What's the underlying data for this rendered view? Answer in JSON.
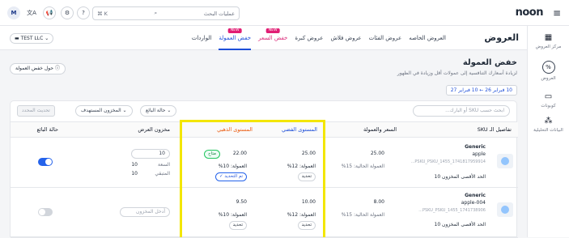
{
  "header": {
    "logo": "noon",
    "search_placeholder": "عمليات البحث",
    "search_shortcut": "K ⌘",
    "avatar_initial": "M"
  },
  "sidebar": {
    "items": [
      {
        "label": "مركز العروض",
        "icon": "grid-icon"
      },
      {
        "label": "العروض",
        "icon": "percent-icon"
      },
      {
        "label": "كوبونات",
        "icon": "ticket-icon"
      },
      {
        "label": "البيانات التحليلية",
        "icon": "analytics-icon"
      }
    ]
  },
  "subheader": {
    "title": "العروض",
    "tabs": [
      {
        "label": "العروض الخاصه",
        "badge": ""
      },
      {
        "label": "عروض الفئات",
        "badge": ""
      },
      {
        "label": "عروض فلاش",
        "badge": ""
      },
      {
        "label": "عروض كبرة",
        "badge": ""
      },
      {
        "label": "خفض السعر",
        "badge": "NEW"
      },
      {
        "label": "خفض العمولة",
        "badge": "NEW"
      },
      {
        "label": "الواردات",
        "badge": ""
      }
    ],
    "store": "TEST LLC"
  },
  "page": {
    "title": "خفض العمولة",
    "description": "لزيادة أسعارك التنافسية إلى عمولات أقل وزيادة في الظهور",
    "about_button": "حول خفض العمولة",
    "date_range": "10 فبراير 26 ← 10 فبراير 27"
  },
  "filters": {
    "search_placeholder": "ابحث حسب SKU أو البارك...",
    "seller_status": "حالة البائع",
    "stock": "المخزون المستهدف",
    "update_button": "تحديث المحدد"
  },
  "table": {
    "headers": {
      "sku": "تفاصيل الـ SKU",
      "price": "السعر والعمولة",
      "golden": "المستوى الفضي",
      "gold": "المستوى الذهبي",
      "stock": "مخزون العرض",
      "status": "حالة البائع"
    },
    "rows": [
      {
        "brand": "Generic",
        "name": "apple",
        "code": "PSKU_PSKU_1455_1741817959914...",
        "stock_label": "الحد الأقصى المخزون 10",
        "price": "25.00",
        "commission": "العمولة الحالية: 15%",
        "silver_price": "25.00",
        "silver_comm": "العمولة: 12%",
        "silver_btn": "تحديد",
        "gold_price": "22.00",
        "gold_comm": "العمولة: 10%",
        "gold_btn": "تم التحديد ✓",
        "gold_badge": "متاح",
        "offer_stock": "10",
        "offer_stock_a": "10",
        "offer_stock_b": "10",
        "offer_label_a": "السعة",
        "offer_label_b": "المتبقي",
        "toggle": "on"
      },
      {
        "brand": "Generic",
        "name": "apple-004",
        "code": "PSKU_PSKU_1455_1741738906...",
        "stock_label": "الحد الأقصى المخزون 10",
        "price": "8.00",
        "commission": "العمولة الحالية: 15%",
        "silver_price": "10.00",
        "silver_comm": "العمولة: 12%",
        "silver_btn": "تحديد",
        "gold_price": "9.50",
        "gold_comm": "العمولة: 10%",
        "gold_btn": "تحديد",
        "offer_placeholder": "أدخل المخزون",
        "toggle": "off"
      }
    ]
  },
  "colors": {
    "accent": "#1d4ed8",
    "highlight": "#f3e600",
    "new_badge": "#e11d74"
  }
}
